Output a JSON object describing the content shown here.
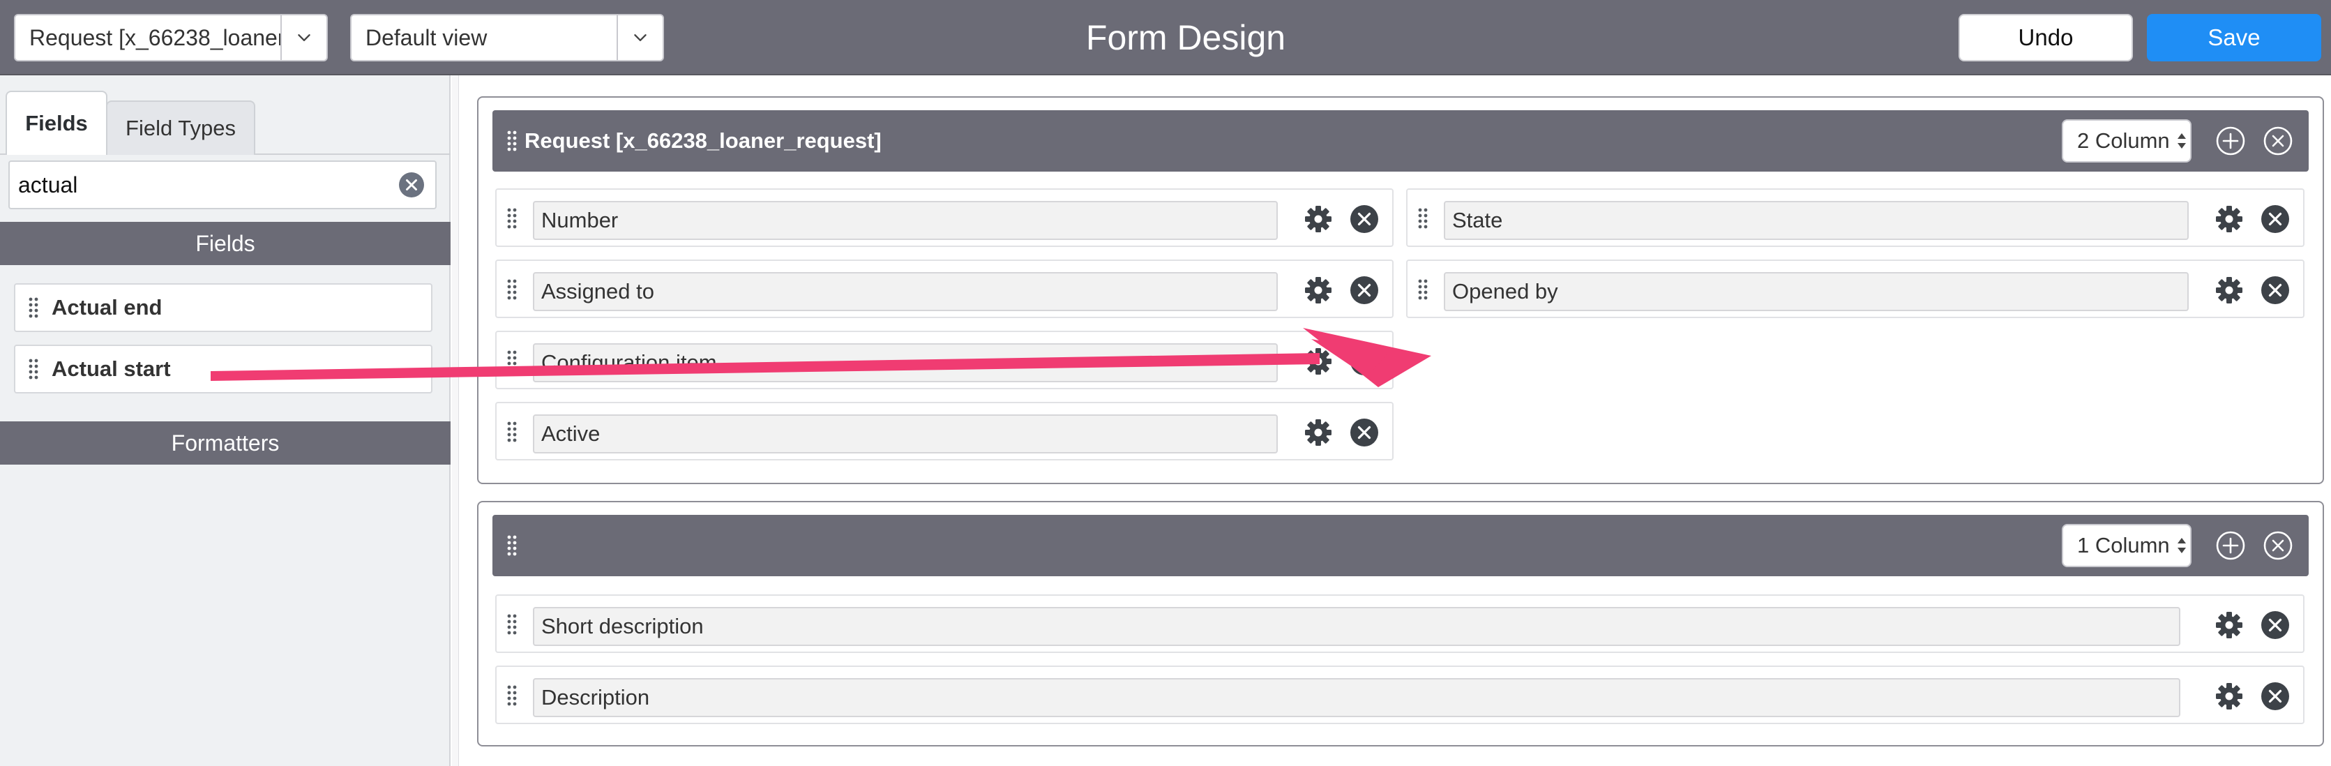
{
  "header": {
    "table_select": "Request [x_66238_loaner_request]",
    "view_select": "Default view",
    "title": "Form Design",
    "undo_label": "Undo",
    "save_label": "Save"
  },
  "left_panel": {
    "tabs": [
      "Fields",
      "Field Types"
    ],
    "search_value": "actual",
    "fields_heading": "Fields",
    "field_items": [
      "Actual end",
      "Actual start"
    ],
    "formatters_heading": "Formatters"
  },
  "sections": [
    {
      "title": "Request [x_66238_loaner_request]",
      "columns": "2 Column",
      "left_fields": [
        "Number",
        "Assigned to",
        "Configuration item",
        "Active"
      ],
      "right_fields": [
        "State",
        "Opened by"
      ]
    },
    {
      "title": "",
      "columns": "1 Column",
      "fields": [
        "Short description",
        "Description"
      ]
    }
  ],
  "icons": {
    "grip": "drag-handle-icon",
    "gear": "gear-icon",
    "remove": "close-circle-icon",
    "add": "plus-circle-icon",
    "clear": "clear-search-icon",
    "caret": "chevron-down-icon"
  },
  "colors": {
    "header_bg": "#6b6b76",
    "save_blue": "#1f8ef5",
    "annotation_arrow": "#f03c72"
  }
}
